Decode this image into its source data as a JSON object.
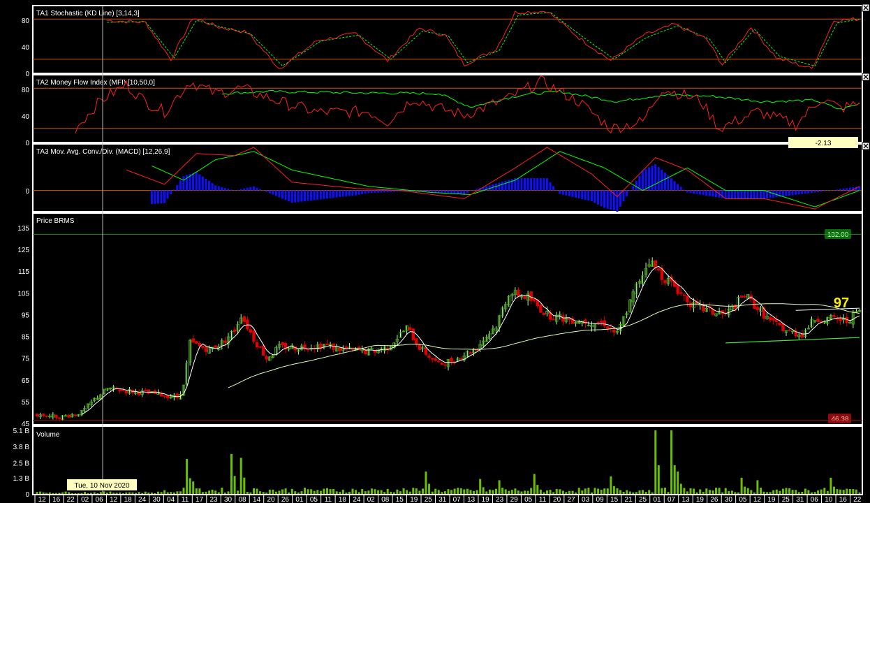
{
  "colors": {
    "background": "#000000",
    "frame": "#ffffff",
    "level_line": "#d45500",
    "up_candle": "#3cb800",
    "down_candle": "#e00000",
    "ma_short": "#ffffff",
    "ma_long": "#d8ffb0",
    "stoch_k": "#ff2020",
    "stoch_d": "#00ff00",
    "macd_line": "#ff2020",
    "macd_signal": "#00ff00",
    "macd_hist": "#1010ff",
    "volume_bar": "#6cbf00",
    "resistance_line": "#2a8a2a",
    "support_line": "#9a1010",
    "trend_line": "#40e040",
    "last_price": "#ffee00",
    "tooltip_bg": "#ffffc0"
  },
  "panels": {
    "stochastic": {
      "title": "TA1 Stochastic (KD Line) [3,14,3]",
      "ticks": [
        "80",
        "40",
        "0"
      ]
    },
    "mfi": {
      "title": "TA2 Money Flow Index (MFI) [10,50,0]",
      "ticks": [
        "80",
        "40",
        "0"
      ],
      "value_box": "-2.13"
    },
    "macd": {
      "title": "TA3 Mov. Avg. Conv./Div. (MACD) [12,26,9]",
      "ticks": [
        "0"
      ]
    },
    "price": {
      "title": "Price BRMS",
      "ticks": [
        "135",
        "125",
        "115",
        "105",
        "95",
        "85",
        "75",
        "65",
        "55",
        "45"
      ],
      "resistance_label": "132.00",
      "support_label": "46.38",
      "last_price": "97"
    },
    "volume": {
      "title": "Volume",
      "ticks": [
        "5.1 B",
        "3.8 B",
        "2.5 B",
        "1.3 B",
        "0"
      ]
    }
  },
  "crosshair_tooltip": "Tue, 10 Nov 2020",
  "chart_data": {
    "type": "candlestick",
    "title": "Price BRMS",
    "ylim": [
      45,
      135
    ],
    "resistance_level": 132,
    "support_level": 46.38,
    "last_close": 97,
    "x_date_labels": [
      "12",
      "16",
      "22",
      "02",
      "06",
      "12",
      "18",
      "24",
      "30",
      "04",
      "11",
      "17",
      "23",
      "30",
      "08",
      "14",
      "20",
      "26",
      "01",
      "05",
      "11",
      "18",
      "24",
      "02",
      "08",
      "15",
      "19",
      "25",
      "31",
      "07",
      "13",
      "19",
      "23",
      "29",
      "05",
      "11",
      "20",
      "27",
      "03",
      "09",
      "15",
      "21",
      "25",
      "01",
      "07",
      "13",
      "19",
      "26",
      "30",
      "05",
      "12",
      "19",
      "25",
      "31",
      "06",
      "10",
      "16",
      "22"
    ],
    "price_keypoints": [
      [
        0,
        49
      ],
      [
        8,
        48
      ],
      [
        14,
        50
      ],
      [
        18,
        56
      ],
      [
        22,
        61
      ],
      [
        28,
        60
      ],
      [
        34,
        59
      ],
      [
        40,
        58
      ],
      [
        44,
        57
      ],
      [
        46,
        62
      ],
      [
        48,
        82
      ],
      [
        54,
        79
      ],
      [
        58,
        82
      ],
      [
        62,
        88
      ],
      [
        64,
        95
      ],
      [
        68,
        84
      ],
      [
        72,
        75
      ],
      [
        76,
        80
      ],
      [
        82,
        80
      ],
      [
        90,
        81
      ],
      [
        96,
        79
      ],
      [
        104,
        78
      ],
      [
        110,
        80
      ],
      [
        116,
        89
      ],
      [
        120,
        80
      ],
      [
        126,
        72
      ],
      [
        132,
        75
      ],
      [
        138,
        80
      ],
      [
        144,
        90
      ],
      [
        148,
        105
      ],
      [
        154,
        103
      ],
      [
        160,
        95
      ],
      [
        166,
        93
      ],
      [
        172,
        92
      ],
      [
        178,
        91
      ],
      [
        182,
        86
      ],
      [
        188,
        108
      ],
      [
        192,
        120
      ],
      [
        196,
        113
      ],
      [
        200,
        108
      ],
      [
        206,
        99
      ],
      [
        212,
        96
      ],
      [
        216,
        95
      ],
      [
        222,
        104
      ],
      [
        226,
        98
      ],
      [
        230,
        92
      ],
      [
        236,
        87
      ],
      [
        240,
        86
      ],
      [
        244,
        93
      ],
      [
        250,
        93
      ],
      [
        254,
        92
      ],
      [
        258,
        97
      ]
    ],
    "volume_ylim": [
      0,
      5.1
    ],
    "volume_keypoints": [
      [
        40,
        0.3
      ],
      [
        47,
        2.8
      ],
      [
        49,
        1.0
      ],
      [
        61,
        3.2
      ],
      [
        64,
        2.9
      ],
      [
        122,
        1.8
      ],
      [
        139,
        1.2
      ],
      [
        145,
        1.1
      ],
      [
        156,
        1.6
      ],
      [
        180,
        1.4
      ],
      [
        194,
        5.1
      ],
      [
        199,
        5.1
      ],
      [
        201,
        1.8
      ],
      [
        221,
        1.3
      ],
      [
        226,
        1.1
      ],
      [
        249,
        1.3
      ]
    ],
    "stochastic_k_keypoints": [
      [
        22,
        78
      ],
      [
        34,
        75
      ],
      [
        42,
        20
      ],
      [
        49,
        82
      ],
      [
        57,
        68
      ],
      [
        66,
        60
      ],
      [
        76,
        6
      ],
      [
        88,
        48
      ],
      [
        100,
        58
      ],
      [
        110,
        18
      ],
      [
        120,
        66
      ],
      [
        128,
        56
      ],
      [
        134,
        12
      ],
      [
        144,
        35
      ],
      [
        150,
        90
      ],
      [
        160,
        92
      ],
      [
        170,
        52
      ],
      [
        180,
        18
      ],
      [
        190,
        55
      ],
      [
        200,
        72
      ],
      [
        210,
        50
      ],
      [
        215,
        12
      ],
      [
        224,
        68
      ],
      [
        232,
        22
      ],
      [
        243,
        6
      ],
      [
        250,
        78
      ],
      [
        258,
        80
      ]
    ],
    "stochastic_d_keypoints": [
      [
        22,
        75
      ],
      [
        34,
        76
      ],
      [
        43,
        22
      ],
      [
        50,
        78
      ],
      [
        58,
        68
      ],
      [
        67,
        58
      ],
      [
        77,
        10
      ],
      [
        89,
        47
      ],
      [
        101,
        56
      ],
      [
        111,
        20
      ],
      [
        121,
        62
      ],
      [
        129,
        55
      ],
      [
        135,
        15
      ],
      [
        145,
        33
      ],
      [
        151,
        86
      ],
      [
        161,
        90
      ],
      [
        171,
        54
      ],
      [
        181,
        20
      ],
      [
        191,
        52
      ],
      [
        201,
        70
      ],
      [
        211,
        50
      ],
      [
        216,
        15
      ],
      [
        225,
        65
      ],
      [
        233,
        24
      ],
      [
        244,
        10
      ],
      [
        251,
        74
      ],
      [
        258,
        80
      ]
    ],
    "mfi_keypoints": [
      [
        12,
        20
      ],
      [
        20,
        62
      ],
      [
        28,
        85
      ],
      [
        34,
        60
      ],
      [
        40,
        45
      ],
      [
        48,
        90
      ],
      [
        56,
        72
      ],
      [
        64,
        80
      ],
      [
        76,
        60
      ],
      [
        88,
        44
      ],
      [
        104,
        45
      ],
      [
        110,
        30
      ],
      [
        118,
        65
      ],
      [
        126,
        50
      ],
      [
        134,
        40
      ],
      [
        148,
        65
      ],
      [
        158,
        90
      ],
      [
        170,
        60
      ],
      [
        180,
        20
      ],
      [
        190,
        30
      ],
      [
        196,
        80
      ],
      [
        208,
        62
      ],
      [
        214,
        20
      ],
      [
        226,
        45
      ],
      [
        238,
        26
      ],
      [
        246,
        65
      ],
      [
        252,
        50
      ],
      [
        258,
        57
      ]
    ],
    "mfi_signal_keypoints": [
      [
        58,
        72
      ],
      [
        72,
        75
      ],
      [
        100,
        73
      ],
      [
        126,
        72
      ],
      [
        136,
        52
      ],
      [
        152,
        70
      ],
      [
        164,
        75
      ],
      [
        182,
        60
      ],
      [
        196,
        70
      ],
      [
        212,
        68
      ],
      [
        228,
        60
      ],
      [
        244,
        62
      ],
      [
        252,
        48
      ],
      [
        258,
        57
      ]
    ],
    "macd_keypoints": [
      [
        28,
        1.0
      ],
      [
        40,
        0.3
      ],
      [
        50,
        1.8
      ],
      [
        62,
        1.7
      ],
      [
        68,
        2.1
      ],
      [
        80,
        0.4
      ],
      [
        100,
        0.1
      ],
      [
        114,
        0
      ],
      [
        134,
        -0.4
      ],
      [
        150,
        1.1
      ],
      [
        160,
        2.1
      ],
      [
        174,
        0.8
      ],
      [
        182,
        -0.3
      ],
      [
        194,
        1.6
      ],
      [
        204,
        1.0
      ],
      [
        216,
        -0.4
      ],
      [
        228,
        -0.4
      ],
      [
        244,
        -0.9
      ],
      [
        258,
        0.2
      ]
    ],
    "macd_signal_keypoints": [
      [
        36,
        1.2
      ],
      [
        46,
        0.5
      ],
      [
        56,
        1.5
      ],
      [
        68,
        1.9
      ],
      [
        80,
        1.0
      ],
      [
        104,
        0.2
      ],
      [
        124,
        -0.1
      ],
      [
        136,
        -0.2
      ],
      [
        150,
        0.5
      ],
      [
        164,
        1.9
      ],
      [
        178,
        1.1
      ],
      [
        190,
        0
      ],
      [
        204,
        1.1
      ],
      [
        216,
        0
      ],
      [
        228,
        0
      ],
      [
        244,
        -0.8
      ],
      [
        258,
        0
      ]
    ],
    "macd_ylim": [
      -1.0,
      2.2
    ]
  }
}
